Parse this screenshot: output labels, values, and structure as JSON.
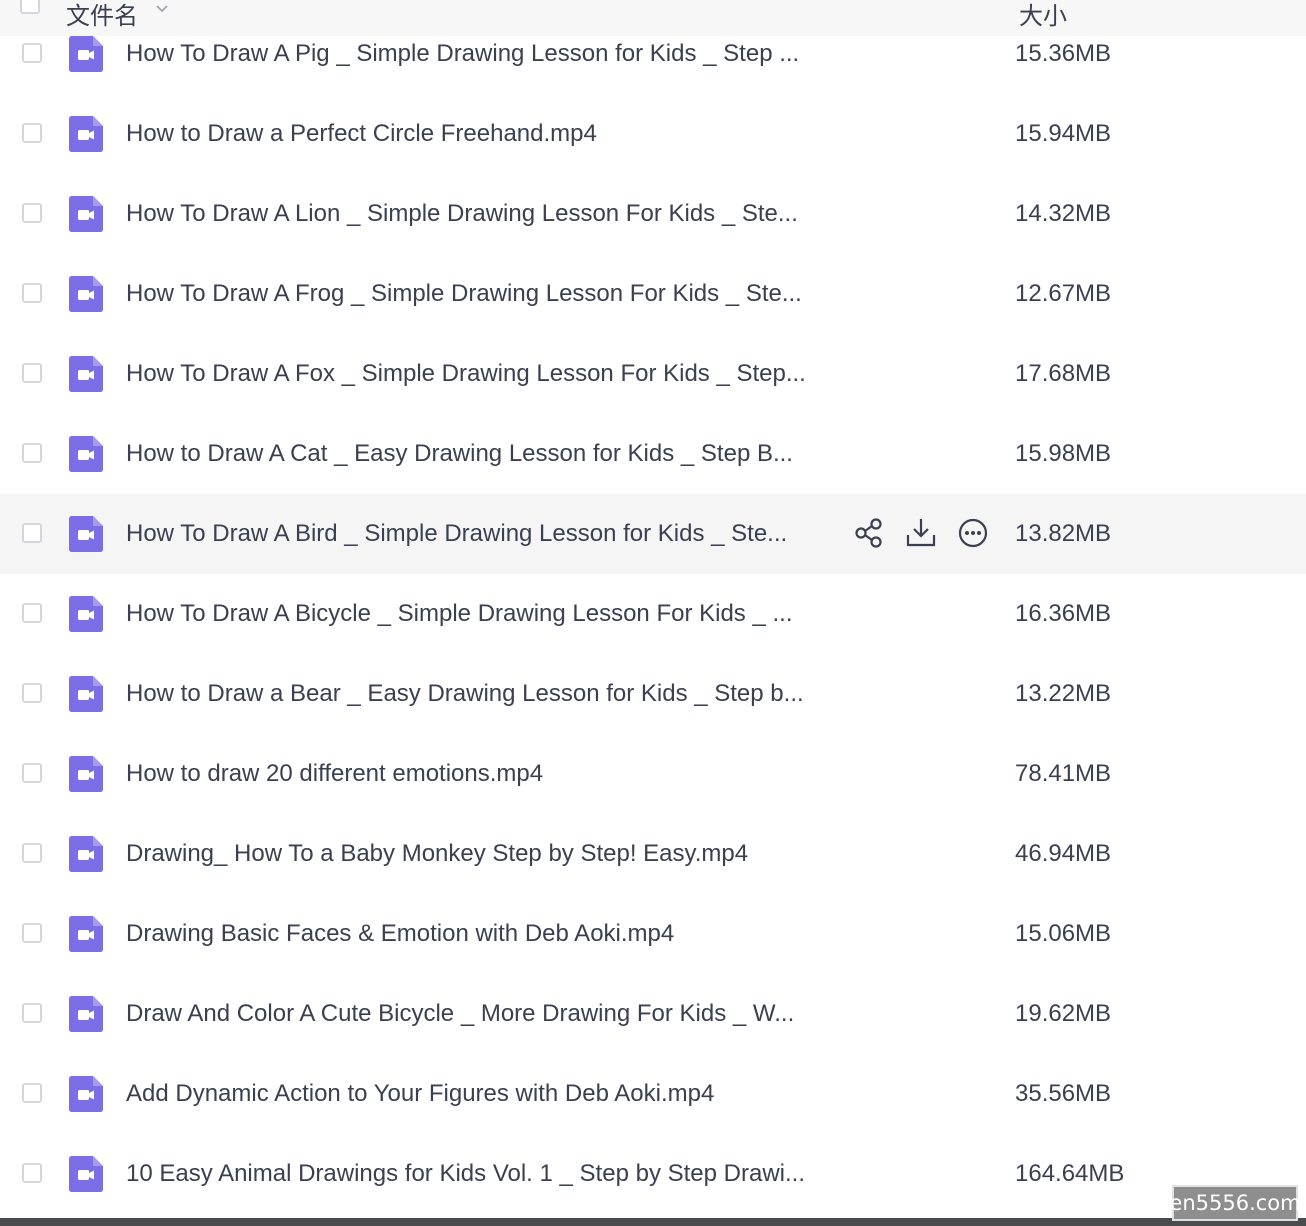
{
  "header": {
    "name_label": "文件名",
    "size_label": "大小"
  },
  "colors": {
    "accent": "#7c6ee6",
    "hover_row": "#f5f5f6",
    "text": "#3b4051"
  },
  "rows": [
    {
      "name": "How To Draw A Pig _ Simple Drawing Lesson for Kids _ Step ...",
      "size": "15.36MB",
      "icon": "video-file-icon"
    },
    {
      "name": "How to Draw a Perfect Circle Freehand.mp4",
      "size": "15.94MB",
      "icon": "video-file-icon"
    },
    {
      "name": "How To Draw A Lion _ Simple Drawing Lesson For Kids _ Ste...",
      "size": "14.32MB",
      "icon": "video-file-icon"
    },
    {
      "name": "How To Draw A Frog _ Simple Drawing Lesson For Kids _ Ste...",
      "size": "12.67MB",
      "icon": "video-file-icon"
    },
    {
      "name": "How To Draw A Fox _ Simple Drawing Lesson For Kids _ Step...",
      "size": "17.68MB",
      "icon": "video-file-icon"
    },
    {
      "name": "How to Draw A Cat _ Easy Drawing Lesson for Kids _ Step B...",
      "size": "15.98MB",
      "icon": "video-file-icon"
    },
    {
      "name": "How To Draw A Bird _ Simple Drawing Lesson for Kids _ Ste...",
      "size": "13.82MB",
      "icon": "video-file-icon"
    },
    {
      "name": "How To Draw A Bicycle _ Simple Drawing Lesson For Kids _ ...",
      "size": "16.36MB",
      "icon": "video-file-icon"
    },
    {
      "name": "How to Draw a Bear _ Easy Drawing Lesson for Kids _ Step b...",
      "size": "13.22MB",
      "icon": "video-file-icon"
    },
    {
      "name": "How to draw 20 different emotions.mp4",
      "size": "78.41MB",
      "icon": "video-file-icon"
    },
    {
      "name": "Drawing_ How To a Baby Monkey Step by Step! Easy.mp4",
      "size": "46.94MB",
      "icon": "video-file-icon"
    },
    {
      "name": "Drawing Basic Faces & Emotion with Deb Aoki.mp4",
      "size": "15.06MB",
      "icon": "video-file-icon"
    },
    {
      "name": "Draw And Color A Cute Bicycle _ More Drawing For Kids _ W...",
      "size": "19.62MB",
      "icon": "video-file-icon"
    },
    {
      "name": "Add Dynamic Action to Your Figures with Deb Aoki.mp4",
      "size": "35.56MB",
      "icon": "video-file-icon"
    },
    {
      "name": "10 Easy Animal Drawings for Kids Vol. 1 _ Step by Step Drawi...",
      "size": "164.64MB",
      "icon": "video-file-icon"
    }
  ],
  "hover_actions": [
    "share-icon",
    "download-icon",
    "more-icon"
  ],
  "watermark": "en5556.com"
}
